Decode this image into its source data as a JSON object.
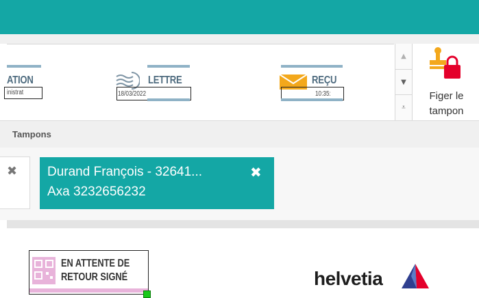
{
  "ribbon": {
    "stamps": [
      {
        "title": "ATION",
        "sub": "inistrat"
      },
      {
        "title": "LETTRE",
        "sub": "18/03/2022"
      },
      {
        "title": "REÇU",
        "sub": "10:35:"
      }
    ],
    "scroll": {
      "up_icon": "triangle-up",
      "down_icon": "triangle-down",
      "more_icon": "expand-more"
    },
    "figer": {
      "label_line1": "Figer le",
      "label_line2": "tampon",
      "icon": "stamp-lock-icon"
    },
    "group_label": "Tampons"
  },
  "tags": {
    "active": {
      "line1": "Durand François - 32641...",
      "line2": "Axa 3232656232",
      "close_glyph": "✖"
    },
    "previous": {
      "close_glyph": "✖"
    }
  },
  "document": {
    "attente_stamp": {
      "line1": "EN ATTENTE DE",
      "line2": "RETOUR SIGNÉ"
    },
    "logo_text": "helvetia"
  },
  "colors": {
    "accent": "#14a7a5",
    "stamp_bar": "#8fb2c6",
    "pink": "#e8b3da",
    "lock_red": "#e4002b",
    "stamp_orange": "#f3a81c"
  }
}
